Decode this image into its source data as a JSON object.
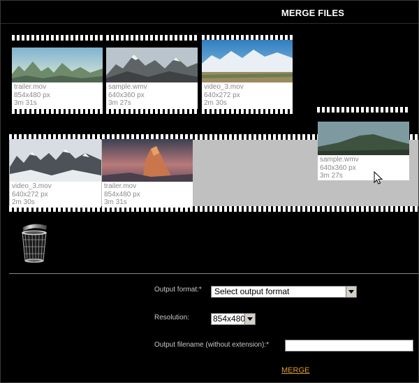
{
  "window": {
    "title": "MERGE FILES"
  },
  "source_clips": [
    {
      "name": "trailer.mov",
      "resolution": "854x480 px",
      "duration": "3m 31s"
    },
    {
      "name": "sample.wmv",
      "resolution": "640x360 px",
      "duration": "3m 27s"
    },
    {
      "name": "video_3.mov",
      "resolution": "640x272 px",
      "duration": "2m 30s"
    }
  ],
  "timeline_clips": [
    {
      "name": "video_3.mov",
      "resolution": "640x272 px",
      "duration": "2m 30s"
    },
    {
      "name": "trailer.mov",
      "resolution": "854x480 px",
      "duration": "3m 31s"
    }
  ],
  "dragging_clip": {
    "name": "sample.wmv",
    "resolution": "640x360 px",
    "duration": "3m 27s"
  },
  "form": {
    "output_format_label": "Output format:*",
    "output_format_value": "Select output format",
    "resolution_label": "Resolution:",
    "resolution_value": "854x480",
    "filename_label": "Output filename (without extension):*",
    "filename_value": "",
    "merge_label": "MERGE"
  },
  "icons": {
    "trash": "trash-can-icon",
    "cursor": "mouse-pointer-icon"
  }
}
